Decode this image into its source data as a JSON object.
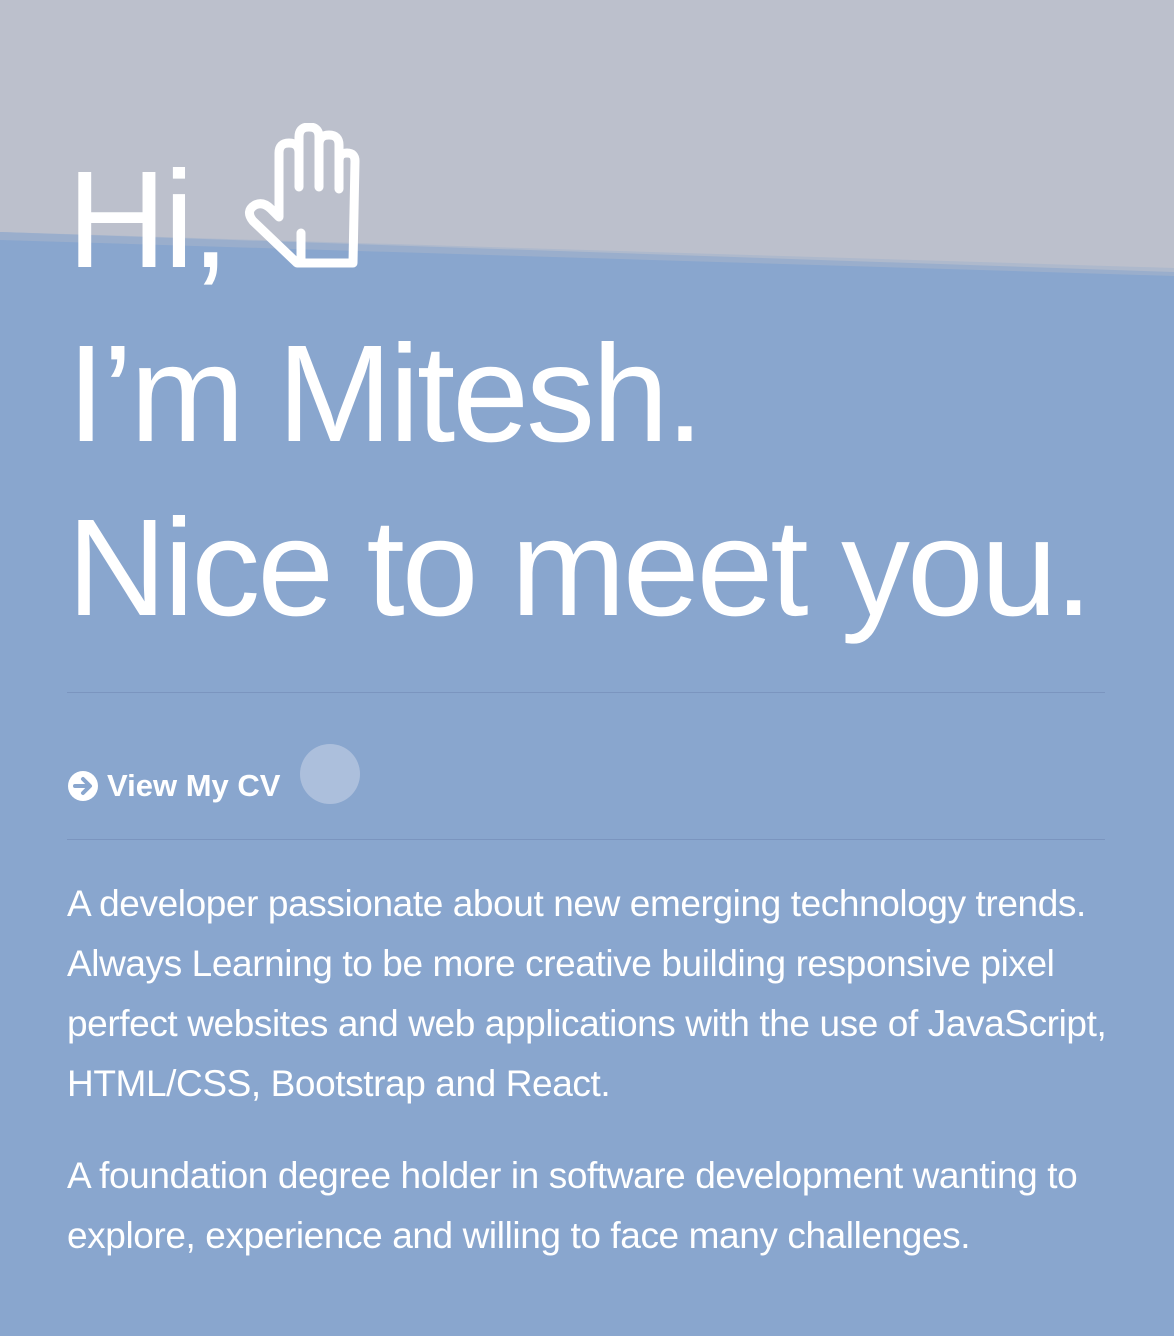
{
  "hero": {
    "greeting": "Hi,",
    "wave_icon": "waving-hand-icon",
    "name_line": "I’m Mitesh.",
    "tagline": "Nice to meet you."
  },
  "cv_link": {
    "icon": "arrow-circle-right-icon",
    "label": "View My CV"
  },
  "about": {
    "paragraph_1": "A developer passionate about new emerging technology trends. Always Learning to be more creative building responsive pixel perfect websites and web applications with the use of JavaScript, HTML/CSS, Bootstrap and React.",
    "paragraph_2": "A foundation degree holder in software development wanting to explore, experience and willing to face many challenges."
  },
  "colors": {
    "background": "#89a6ce",
    "top_band": "#bcc0cc",
    "text": "#ffffff",
    "divider": "#7b95bf"
  }
}
